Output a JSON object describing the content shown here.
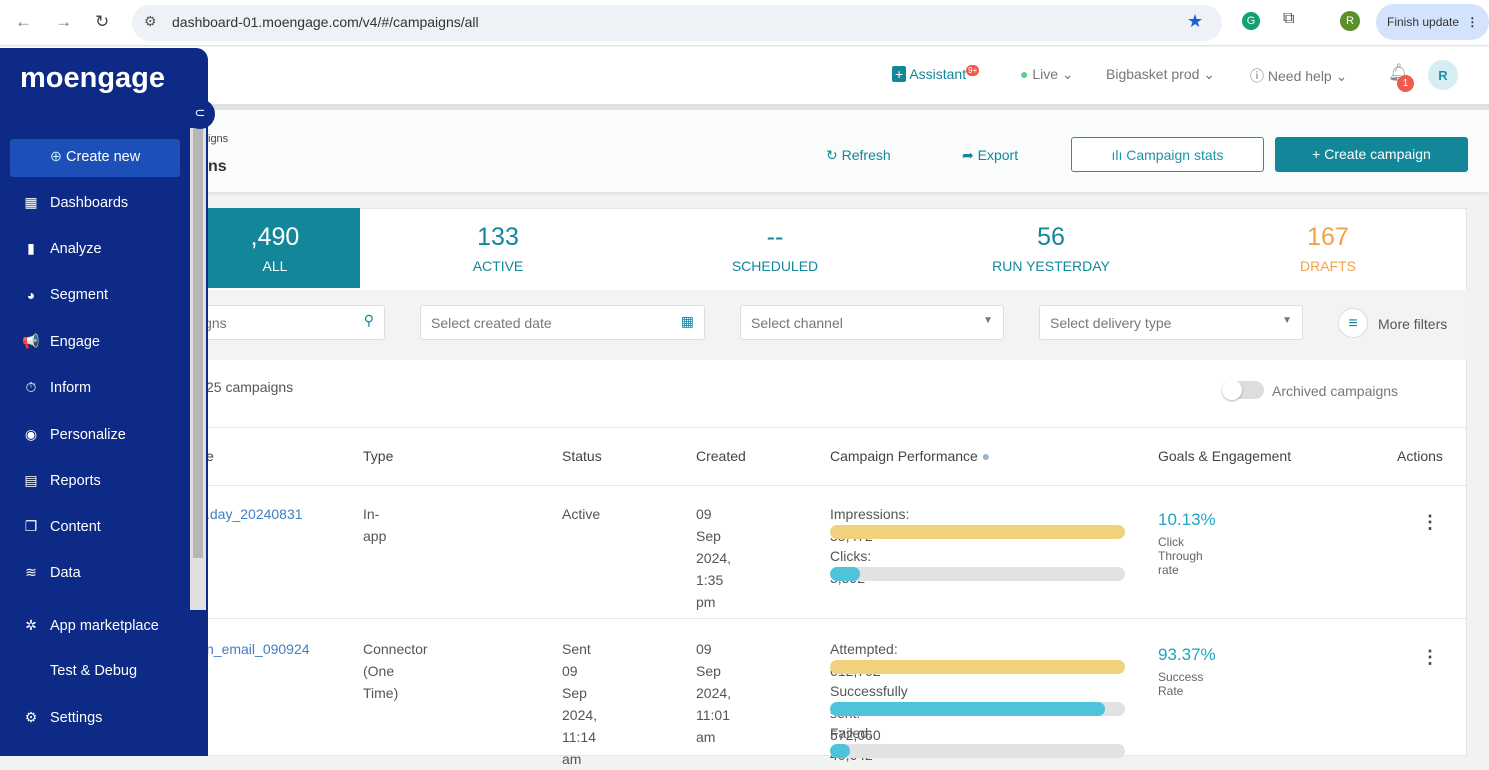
{
  "browser": {
    "url": "dashboard-01.moengage.com/v4/#/campaigns/all",
    "finish_update": "Finish update",
    "profile_initial": "R"
  },
  "topbar": {
    "assistant": "Assistant",
    "assistant_badge": "9+",
    "live": "Live",
    "workspace": "Bigbasket prod",
    "help": "Need help",
    "notif_count": "1",
    "avatar": "R"
  },
  "page": {
    "breadcrumb": "igns",
    "title": "ns",
    "refresh": "Refresh",
    "export": "Export",
    "campaign_stats": "Campaign stats",
    "create_campaign": "Create campaign"
  },
  "stats": [
    {
      "value": ",490",
      "label": "ALL",
      "color": "#ffffff"
    },
    {
      "value": "133",
      "label": "ACTIVE",
      "color": "#13879a"
    },
    {
      "value": "--",
      "label": "SCHEDULED",
      "color": "#13879a"
    },
    {
      "value": "56",
      "label": "RUN YESTERDAY",
      "color": "#13879a"
    },
    {
      "value": "167",
      "label": "DRAFTS",
      "color": "#f0a24a"
    }
  ],
  "filters": {
    "search_placeholder": "igns",
    "date_placeholder": "Select created date",
    "channel_placeholder": "Select channel",
    "delivery_placeholder": "Select delivery type",
    "more_filters": "More filters"
  },
  "list": {
    "count": "25 campaigns",
    "archived": "Archived campaigns",
    "archived_on": false
  },
  "table": {
    "headers": [
      "e",
      "Type",
      "Status",
      "Created",
      "Campaign Performance",
      "Goals & Engagement",
      "Actions"
    ],
    "rows": [
      {
        "name": ".day_20240831",
        "type": "In-app",
        "type2": "",
        "status": "Active",
        "status2": "",
        "status3": "",
        "created": "09 Sep 2024,",
        "created2": "1:35 pm",
        "metrics": [
          {
            "label": "Impressions: 35,472",
            "fill": 100,
            "color": "#f0d27e"
          },
          {
            "label": "Clicks: 3,592",
            "fill": 10.13,
            "color": "#4fc3da"
          }
        ],
        "goal": "10.13%",
        "goal_label": "Click Through rate"
      },
      {
        "name": "n_email_090924",
        "type": "Connector",
        "type2": "(One Time)",
        "status": "Sent",
        "status2": "09 Sep 2024,",
        "status3": "11:14 am",
        "created": "09 Sep 2024,",
        "created2": "11:01 am",
        "metrics": [
          {
            "label": "Attempted: 612,702",
            "fill": 100,
            "color": "#f0d27e"
          },
          {
            "label": "Successfully sent: 572,060",
            "fill": 93.37,
            "color": "#4fc3da"
          },
          {
            "label": "Failed: 40,642",
            "fill": 6.63,
            "color": "#4fc3da"
          }
        ],
        "goal": "93.37%",
        "goal_label": "Success Rate"
      }
    ]
  },
  "sidebar": {
    "logo": "moengage",
    "create_new": "Create new",
    "items": [
      {
        "label": "Dashboards",
        "icon": "dashboard-icon",
        "glyph": "▦"
      },
      {
        "label": "Analyze",
        "icon": "analyze-icon",
        "glyph": "▮"
      },
      {
        "label": "Segment",
        "icon": "segment-icon",
        "glyph": "◕"
      },
      {
        "label": "Engage",
        "icon": "engage-icon",
        "glyph": "📢"
      },
      {
        "label": "Inform",
        "icon": "inform-icon",
        "glyph": "⏱"
      },
      {
        "label": "Personalize",
        "icon": "personalize-icon",
        "glyph": "◉"
      },
      {
        "label": "Reports",
        "icon": "reports-icon",
        "glyph": "▤"
      },
      {
        "label": "Content",
        "icon": "content-icon",
        "glyph": "❐"
      },
      {
        "label": "Data",
        "icon": "data-icon",
        "glyph": "≋"
      },
      {
        "label": "App marketplace",
        "icon": "marketplace-icon",
        "glyph": "✲"
      },
      {
        "label": "Test & Debug",
        "icon": "debug-icon",
        "glyph": "</>"
      },
      {
        "label": "Settings",
        "icon": "settings-icon",
        "glyph": "⚙"
      }
    ]
  }
}
